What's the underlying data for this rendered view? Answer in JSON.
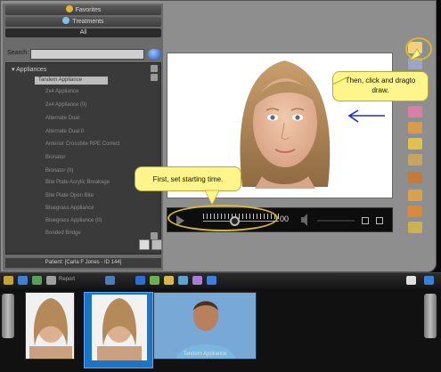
{
  "sidebar": {
    "tabs": [
      {
        "label": "Favorites",
        "icon": "star-icon"
      },
      {
        "label": "Treatments",
        "icon": "treatment-icon"
      },
      {
        "label": "All",
        "icon": ""
      }
    ],
    "search_label": "Search:",
    "search_value": "",
    "tree_root": "Appliances",
    "tree_items": [
      "Tandem Appliance",
      "2x4 Appliance",
      "2x4 Appliance (II)",
      "Alternate Dual",
      "Alternate Dual II",
      "Anterior Crossbite RPE Correct",
      "Bionator",
      "Bionator (II)",
      "Bite Plate Acrylic Breakage",
      "Bite Plate Open Bite",
      "Bluegrass Appliance",
      "Bluegrass Appliance (II)",
      "Bonded Bridge"
    ],
    "patient_label": "Patient: [Carla F Jones · ID 144]"
  },
  "tutorial": {
    "draw_callout": "Then, click and dragto draw.",
    "time_callout": "First, set starting time."
  },
  "player": {
    "loop_text": "00"
  },
  "tray": {
    "label": "Report",
    "thumbnails": [
      {
        "caption": ""
      },
      {
        "caption": ""
      },
      {
        "caption": "Tandem Appliance"
      }
    ]
  },
  "colors": {
    "callout": "#fff58a",
    "highlight": "#d6b830",
    "annotation_arrow": "#1a2bd6"
  }
}
